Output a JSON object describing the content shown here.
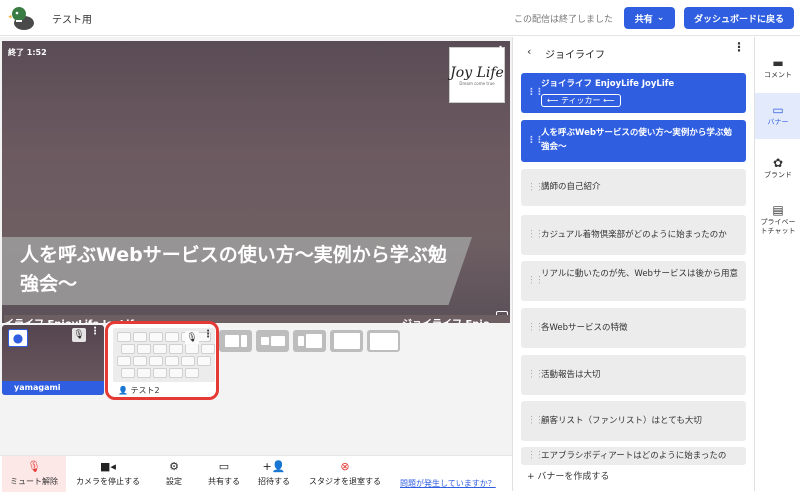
{
  "header": {
    "title": "テスト用",
    "ended_text": "この配信は終了しました",
    "share_label": "共有",
    "dashboard_label": "ダッシュボードに戻る"
  },
  "stage": {
    "timer": "終了 1:52",
    "logo_text": "Joy Life",
    "logo_sub": "Dream come true",
    "banner_text": "人を呼ぶWebサービスの使い方〜実例から学ぶ勉強会〜",
    "ticker_left": "イライフ EnjoyLife JoyLife",
    "ticker_right": "ジョイライフ Enjo"
  },
  "participants": [
    {
      "name": "yamagami"
    },
    {
      "name": "テスト2"
    }
  ],
  "bottombar": {
    "mute": "ミュート解除",
    "camera": "カメラを停止する",
    "settings": "設定",
    "share": "共有する",
    "invite": "招待する",
    "leave": "スタジオを退室する",
    "issue": "問題が発生していますか？"
  },
  "panel": {
    "title": "ジョイライフ",
    "cards": [
      {
        "text": "ジョイライフ EnjoyLife JoyLife",
        "tag": "⟵ ティッカー ⟵"
      },
      {
        "text": "人を呼ぶWebサービスの使い方〜実例から学ぶ勉強会〜"
      },
      {
        "text": "講師の自己紹介"
      },
      {
        "text": "カジュアル着物倶楽部がどのように始まったのか"
      },
      {
        "text": "リアルに動いたのが先、Webサービスは後から用意"
      },
      {
        "text": "各Webサービスの特徴"
      },
      {
        "text": "活動報告は大切"
      },
      {
        "text": "顧客リスト（ファンリスト）はとても大切"
      },
      {
        "text": "エアブラシボディアートはどのように始まったの"
      }
    ],
    "create_label": "+ バナーを作成する"
  },
  "rail": {
    "comment": "コメント",
    "banner": "バナー",
    "brand": "ブランド",
    "private_chat": "プライベートチャット"
  },
  "colors": {
    "accent": "#2f5ee0",
    "danger": "#e53935"
  }
}
